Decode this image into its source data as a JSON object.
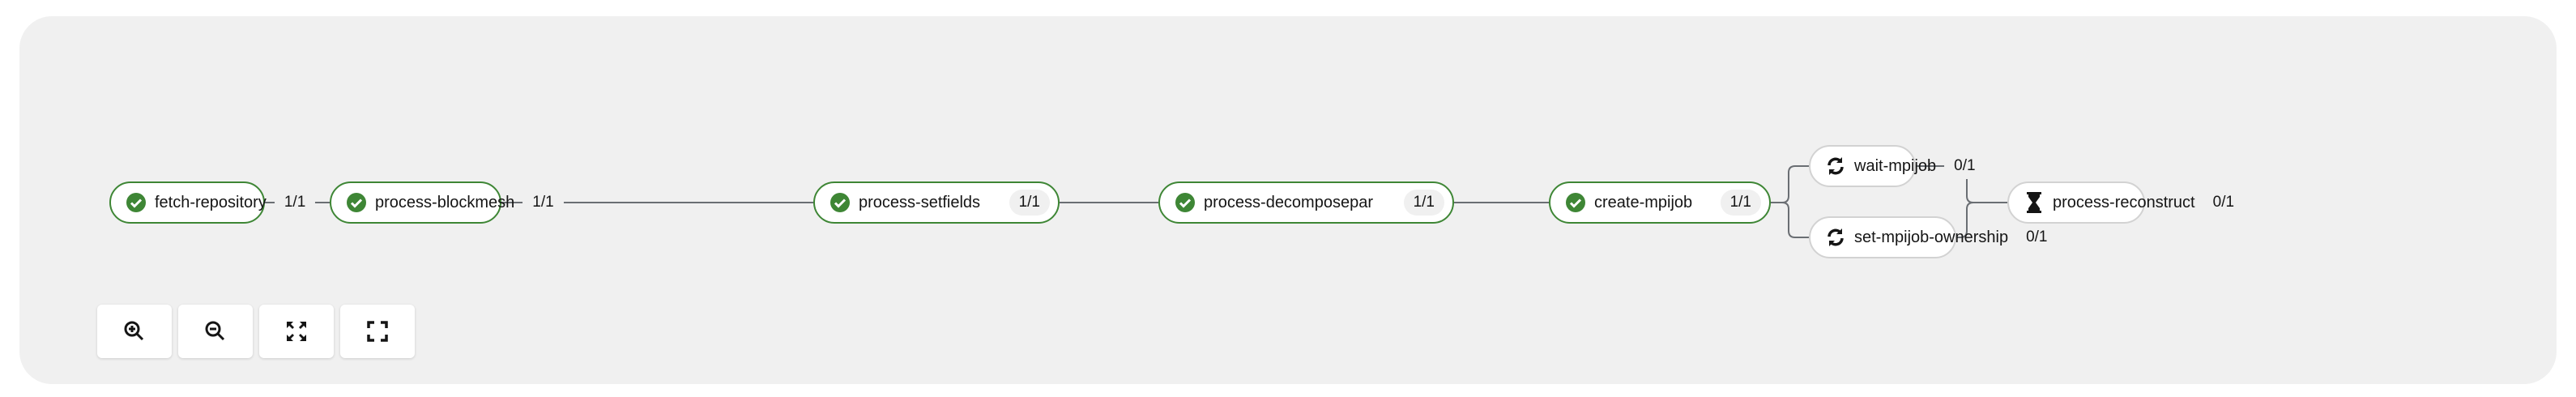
{
  "colors": {
    "success": "#3e8635",
    "pending": "#151515",
    "background": "#f0f0f0"
  },
  "nodes": [
    {
      "name": "fetch-repository",
      "count": "1/1",
      "status": "succeeded",
      "icon": "check-circle-icon"
    },
    {
      "name": "process-blockmesh",
      "count": "1/1",
      "status": "succeeded",
      "icon": "check-circle-icon"
    },
    {
      "name": "process-setfields",
      "count": "1/1",
      "status": "succeeded",
      "icon": "check-circle-icon"
    },
    {
      "name": "process-decomposepar",
      "count": "1/1",
      "status": "succeeded",
      "icon": "check-circle-icon"
    },
    {
      "name": "create-mpijob",
      "count": "1/1",
      "status": "succeeded",
      "icon": "check-circle-icon"
    },
    {
      "name": "wait-mpijob",
      "count": "0/1",
      "status": "running",
      "icon": "sync-icon"
    },
    {
      "name": "set-mpijob-ownership",
      "count": "0/1",
      "status": "running",
      "icon": "sync-icon"
    },
    {
      "name": "process-reconstruct",
      "count": "0/1",
      "status": "pending",
      "icon": "hourglass-icon"
    }
  ],
  "controls": [
    {
      "name": "zoom-in",
      "icon": "zoom-in-icon"
    },
    {
      "name": "zoom-out",
      "icon": "zoom-out-icon"
    },
    {
      "name": "fit-to-screen",
      "icon": "expand-arrows-icon"
    },
    {
      "name": "reset-view",
      "icon": "expand-icon"
    }
  ]
}
